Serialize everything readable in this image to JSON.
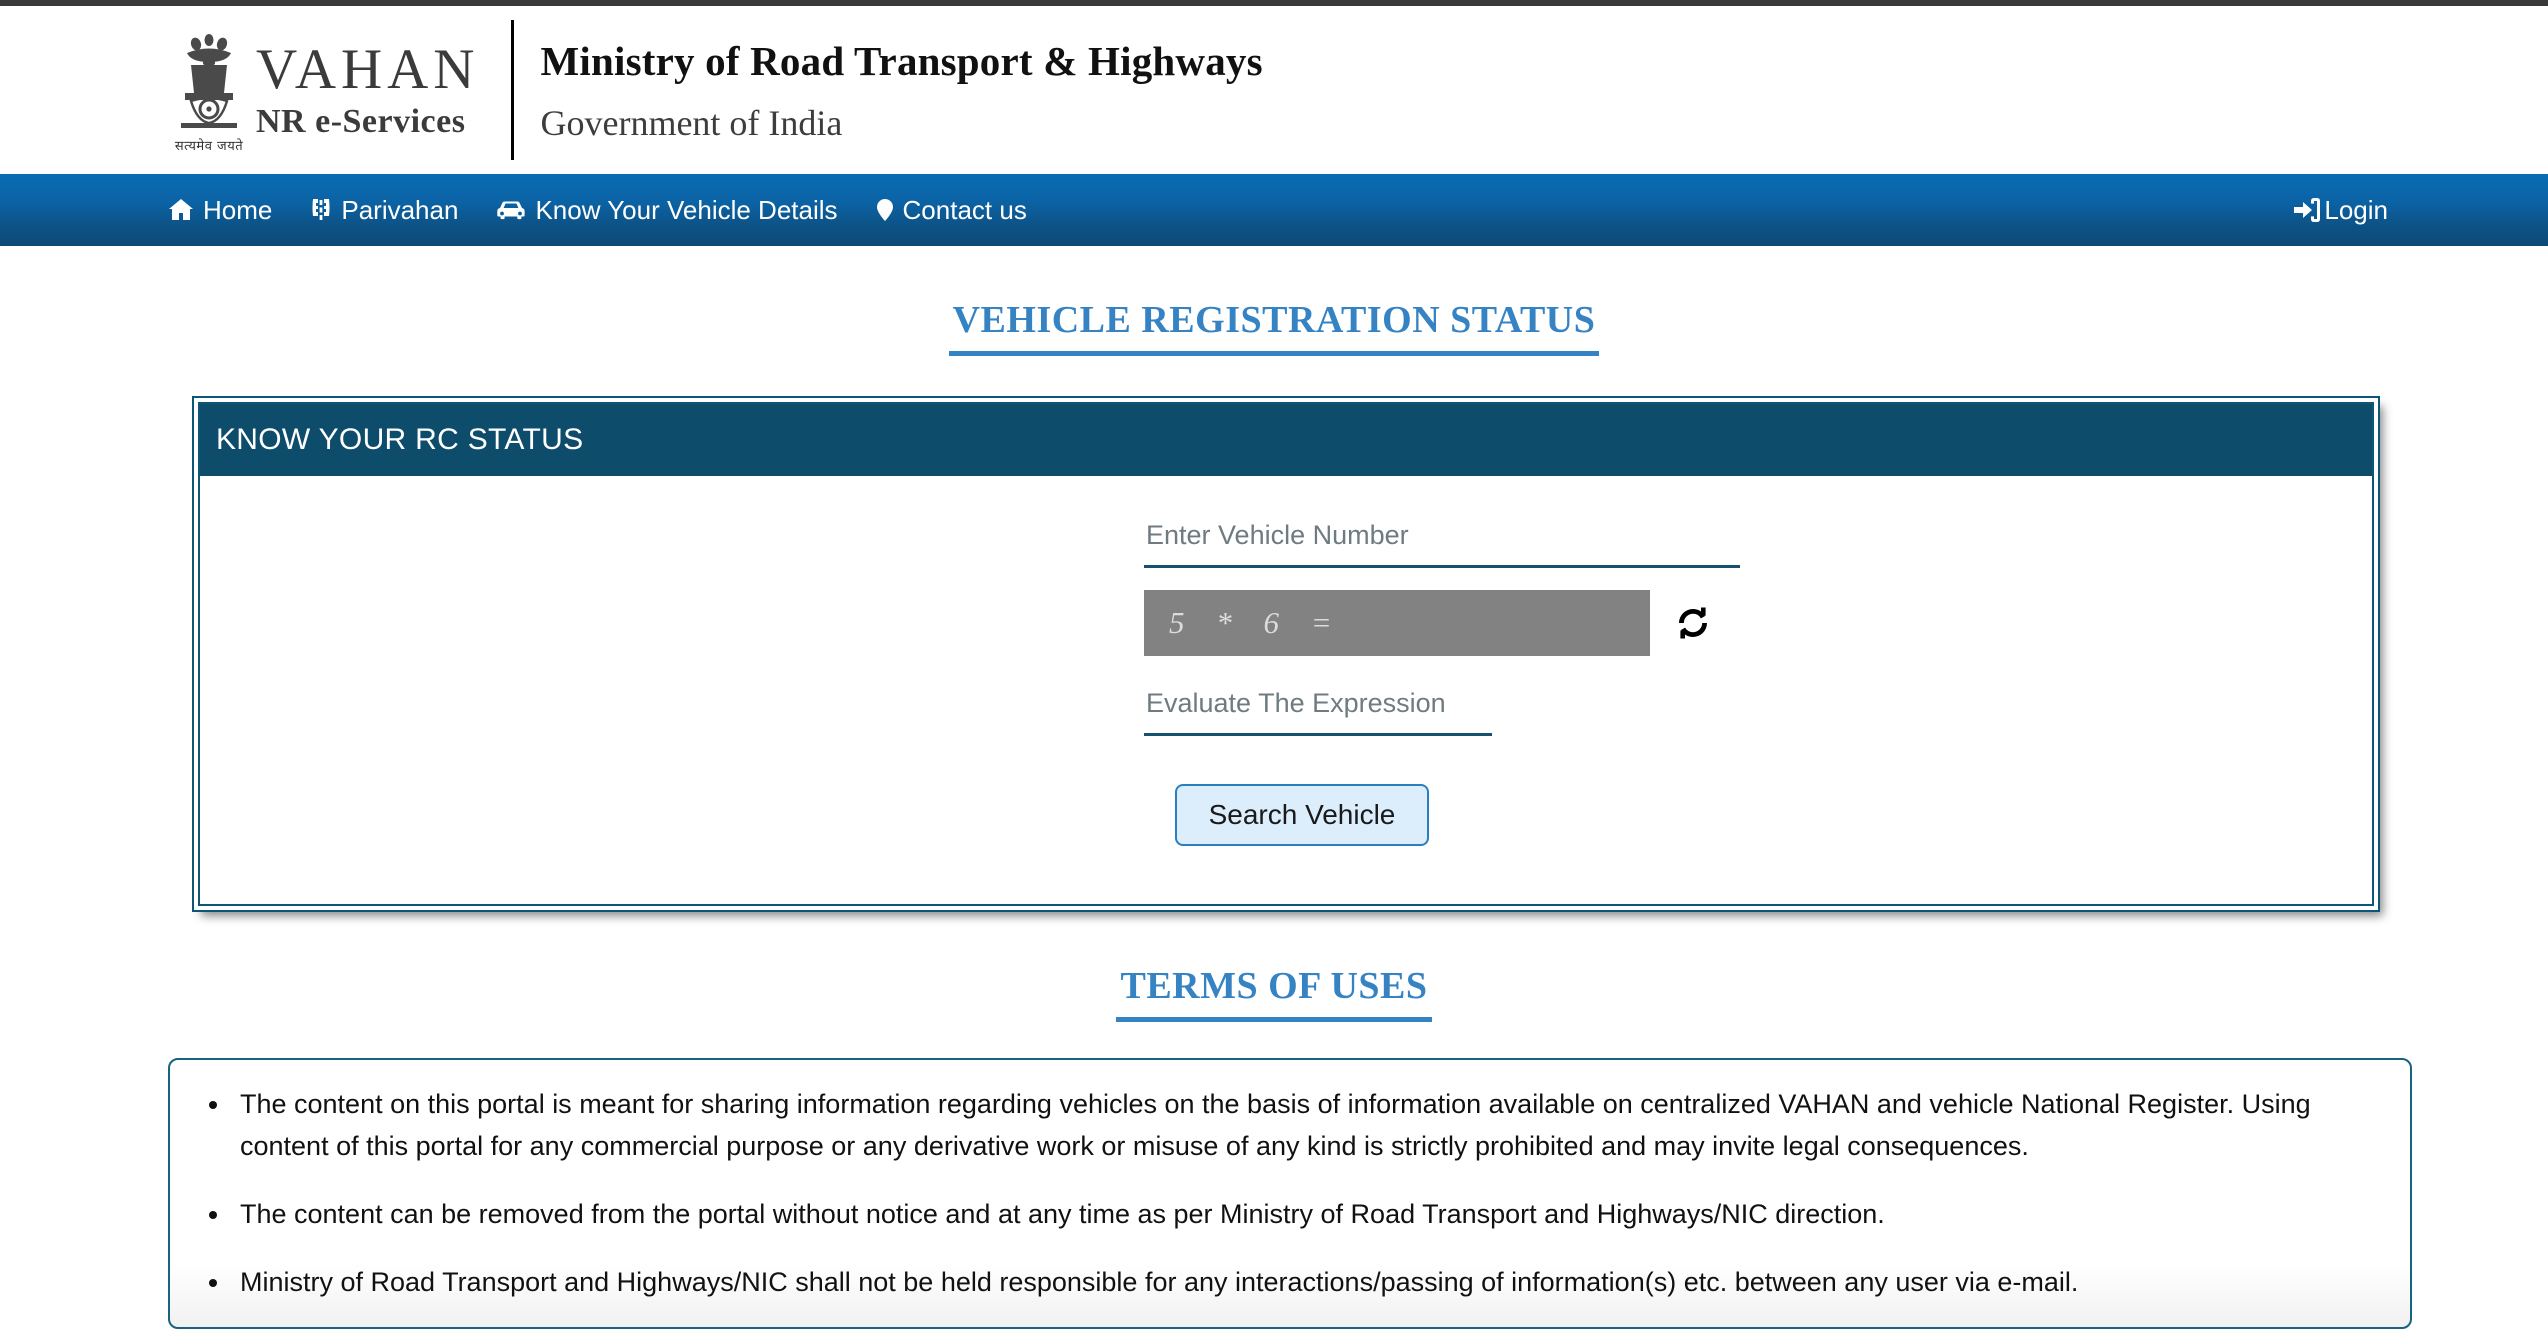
{
  "brand": {
    "logo_title": "VAHAN",
    "logo_subtitle": "NR e-Services",
    "emblem_motto": "सत्यमेव जयते",
    "ministry_line1": "Ministry of Road Transport & Highways",
    "ministry_line2": "Government of India"
  },
  "nav": {
    "items": [
      {
        "label": "Home",
        "icon": "home-icon"
      },
      {
        "label": "Parivahan",
        "icon": "road-icon"
      },
      {
        "label": "Know Your Vehicle Details",
        "icon": "car-icon"
      },
      {
        "label": "Contact us",
        "icon": "map-pin-icon"
      }
    ],
    "login": {
      "label": "Login",
      "icon": "sign-in-icon"
    }
  },
  "page": {
    "title": "VEHICLE REGISTRATION STATUS"
  },
  "card": {
    "title": "KNOW YOUR RC STATUS",
    "vehicle_number": {
      "value": "",
      "placeholder": "Enter Vehicle Number"
    },
    "captcha": {
      "expression": "5 * 6 =",
      "refresh_icon": "refresh-icon"
    },
    "captcha_answer": {
      "value": "",
      "placeholder": "Evaluate The Expression"
    },
    "search_button": "Search Vehicle"
  },
  "terms": {
    "title": "TERMS OF USES",
    "items": [
      "The content on this portal is meant for sharing information regarding vehicles on the basis of information available on centralized VAHAN and vehicle National Register. Using content of this portal for any commercial purpose or any derivative work or misuse of any kind is strictly prohibited and may invite legal consequences.",
      "The content can be removed from the portal without notice and at any time as per Ministry of Road Transport and Highways/NIC direction.",
      "Ministry of Road Transport and Highways/NIC shall not be held responsible for any interactions/passing of information(s) etc. between any user via e-mail."
    ]
  },
  "colors": {
    "nav_top": "#0a6cb4",
    "nav_bottom": "#0c4a77",
    "heading_blue": "#3683c4",
    "card_header": "#0e4c6b",
    "card_border": "#0e5678",
    "button_bg": "#dceefb",
    "button_border": "#2a7fc0",
    "captcha_bg": "#828282"
  }
}
